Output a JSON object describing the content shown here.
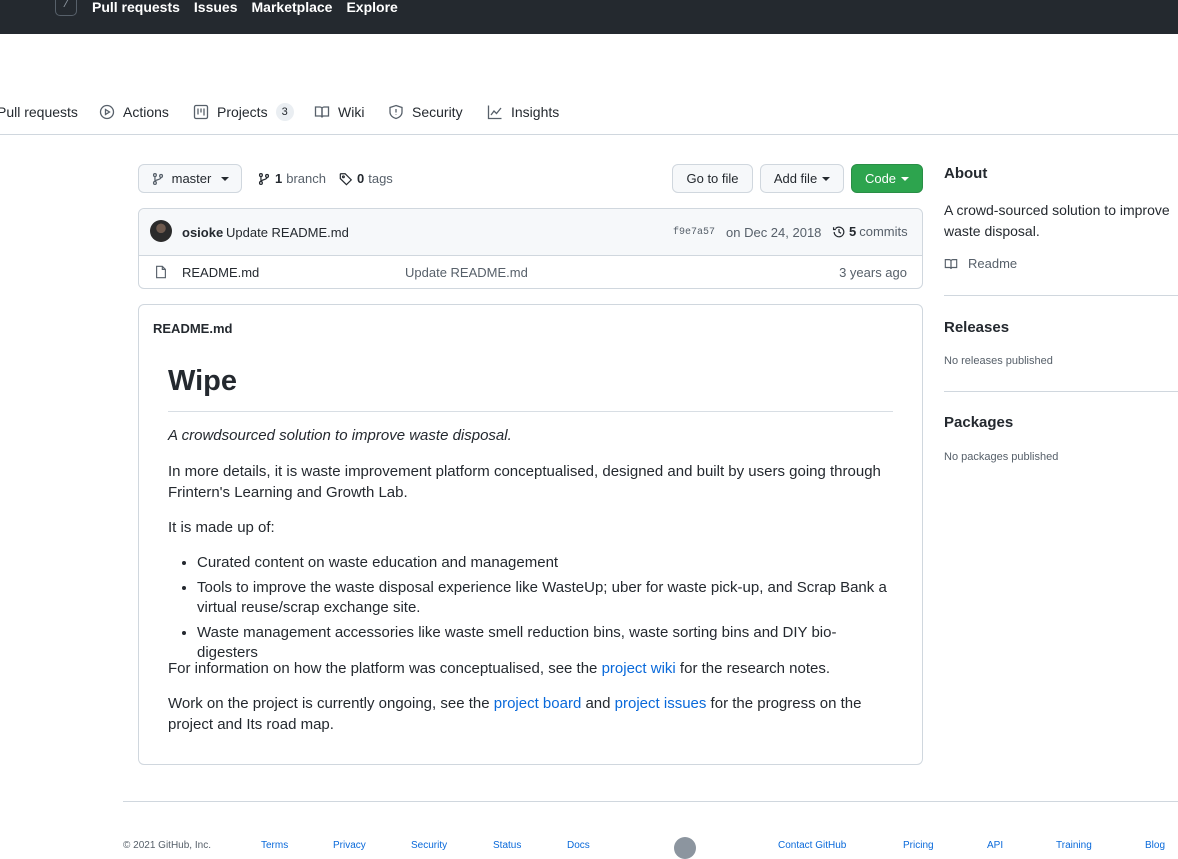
{
  "topbar": {
    "slash_key": "/",
    "nav": [
      "Pull requests",
      "Issues",
      "Marketplace",
      "Explore"
    ]
  },
  "repo_nav": {
    "pull_requests": "Pull requests",
    "actions": "Actions",
    "projects": "Projects",
    "projects_count": "3",
    "wiki": "Wiki",
    "security": "Security",
    "insights": "Insights"
  },
  "toolbar": {
    "branch_select": "master",
    "branch_count": "1",
    "branch_label": "branch",
    "tag_count": "0",
    "tag_label": "tags",
    "go_to_file": "Go to file",
    "add_file": "Add file",
    "code": "Code"
  },
  "commit": {
    "author": "osioke",
    "message": "Update README.md",
    "sha": "f9e7a57",
    "date": "on Dec 24, 2018",
    "count": "5",
    "count_label": "commits"
  },
  "files": [
    {
      "name": "README.md",
      "message": "Update README.md",
      "age": "3 years ago"
    }
  ],
  "readme": {
    "header": "README.md",
    "title": "Wipe",
    "tagline": "A crowdsourced solution to improve waste disposal.",
    "para1": "In more details, it is waste improvement platform conceptualised, designed and built by users going through Frintern's Learning and Growth Lab.",
    "para2": "It is made up of:",
    "list": [
      "Curated content on waste education and management",
      "Tools to improve the waste disposal experience like WasteUp; uber for waste pick-up, and Scrap Bank a virtual reuse/scrap exchange site.",
      "Waste management accessories like waste smell reduction bins, waste sorting bins and DIY bio-digesters"
    ],
    "para3_pre": "For information on how the platform was conceptualised, see the ",
    "para3_link": "project wiki",
    "para3_post": " for the research notes.",
    "para4_pre": "Work on the project is currently ongoing, see the ",
    "para4_link1": "project board",
    "para4_mid": " and ",
    "para4_link2": "project issues",
    "para4_post": " for the progress on the project and Its road map."
  },
  "sidebar": {
    "about_title": "About",
    "about_text": "A crowd-sourced solution to improve waste disposal.",
    "readme_link": "Readme",
    "releases_title": "Releases",
    "releases_text": "No releases published",
    "packages_title": "Packages",
    "packages_text": "No packages published"
  },
  "footer": {
    "copyright": "© 2021 GitHub, Inc.",
    "links": [
      "Terms",
      "Privacy",
      "Security",
      "Status",
      "Docs",
      "Contact GitHub",
      "Pricing",
      "API",
      "Training",
      "Blog"
    ]
  },
  "colors": {
    "accent": "#0969da",
    "code_button": "#2da44e",
    "header_bg": "#24292f"
  }
}
